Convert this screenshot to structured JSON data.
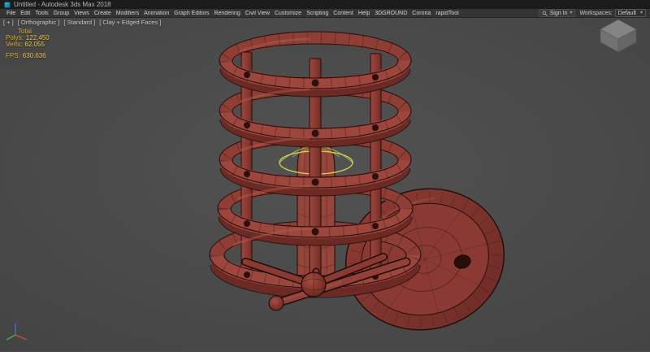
{
  "window": {
    "title": "Untitled - Autodesk 3ds Max 2018"
  },
  "menu_bar": {
    "items": [
      "File",
      "Edit",
      "Tools",
      "Group",
      "Views",
      "Create",
      "Modifiers",
      "Animation",
      "Graph Editors",
      "Rendering",
      "Civil View",
      "Customize",
      "Scripting",
      "Content",
      "Help",
      "3DGROUND",
      "Corona",
      "rapidTool"
    ],
    "sign_in_label": "Sign In",
    "workspaces_label": "Workspaces:",
    "workspace_selected": "Default"
  },
  "viewport": {
    "labels": {
      "menu": "[ + ]",
      "view": "[ Orthographic ]",
      "standard": "[ Standard ]",
      "shading": "[ Clay + Edged Faces ]"
    },
    "statistics": {
      "total_label": "Total",
      "polys_label": "Polys:",
      "polys_value": "122,450",
      "verts_label": "Verts:",
      "verts_value": "62,055",
      "fps_label": "FPS:",
      "fps_value": "630.636"
    }
  },
  "icons": {
    "app_icon": "3ds-max-logo",
    "search_icon": "magnifier",
    "caret": "▾",
    "viewcube": "home-cube",
    "axis_tripod": "world-axis-xyz"
  },
  "colors": {
    "titlebar_bg": "#1b1b1b",
    "menubar_bg": "#343434",
    "viewport_bg": "#4a4a4a",
    "stats_label": "#d9ae35",
    "stats_value": "#e4c44e",
    "vp_label_text": "#cfcfcf",
    "model_red": "#9d463d",
    "model_red_dark": "#6d2a24",
    "wire_edge": "#240f0c",
    "gizmo_yellow": "#d8d550",
    "gizmo_green": "#9fae44"
  }
}
